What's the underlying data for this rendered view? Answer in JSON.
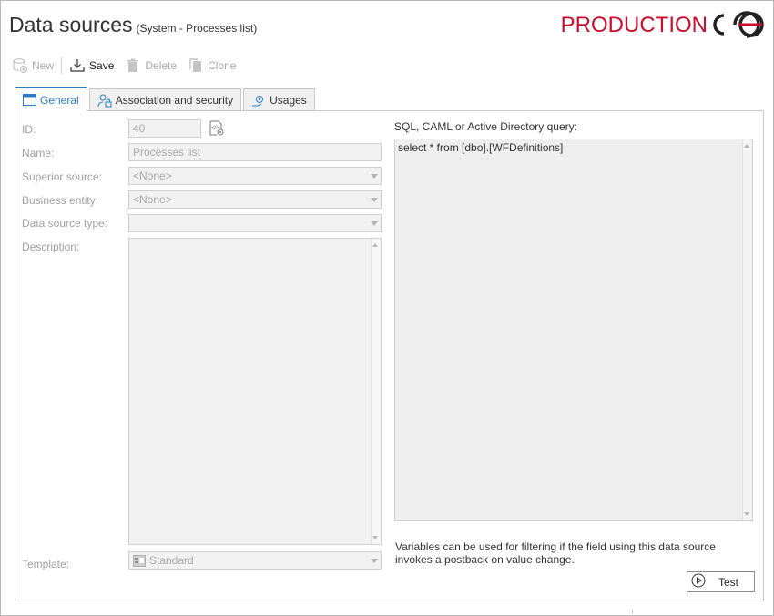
{
  "header": {
    "title": "Data sources",
    "subtitle": "(System - Processes list)",
    "environment": "PRODUCTION",
    "brand_color": "#c8102e"
  },
  "toolbar": {
    "new_label": "New",
    "save_label": "Save",
    "delete_label": "Delete",
    "clone_label": "Clone"
  },
  "tabs": [
    {
      "label": "General",
      "icon": "window-icon",
      "active": true
    },
    {
      "label": "Association and security",
      "icon": "user-lock-icon",
      "active": false
    },
    {
      "label": "Usages",
      "icon": "gear-hand-icon",
      "active": false
    }
  ],
  "form": {
    "id_label": "ID:",
    "id_value": "40",
    "name_label": "Name:",
    "name_value": "Processes list",
    "superior_label": "Superior source:",
    "superior_value": "<None>",
    "business_label": "Business entity:",
    "business_value": "<None>",
    "type_label": "Data source type:",
    "type_value": "",
    "description_label": "Description:",
    "description_value": "",
    "template_label": "Template:",
    "template_value": "Standard"
  },
  "query": {
    "label": "SQL, CAML or Active Directory query:",
    "value": "select * from [dbo].[WFDefinitions]",
    "note": "Variables can be used for filtering if the field using this data source invokes a postback on value change.",
    "test_label": "Test"
  },
  "colors": {
    "accent": "#2a7cc7",
    "disabled_text": "#a8a8a8",
    "field_bg": "#f2f2f2"
  }
}
